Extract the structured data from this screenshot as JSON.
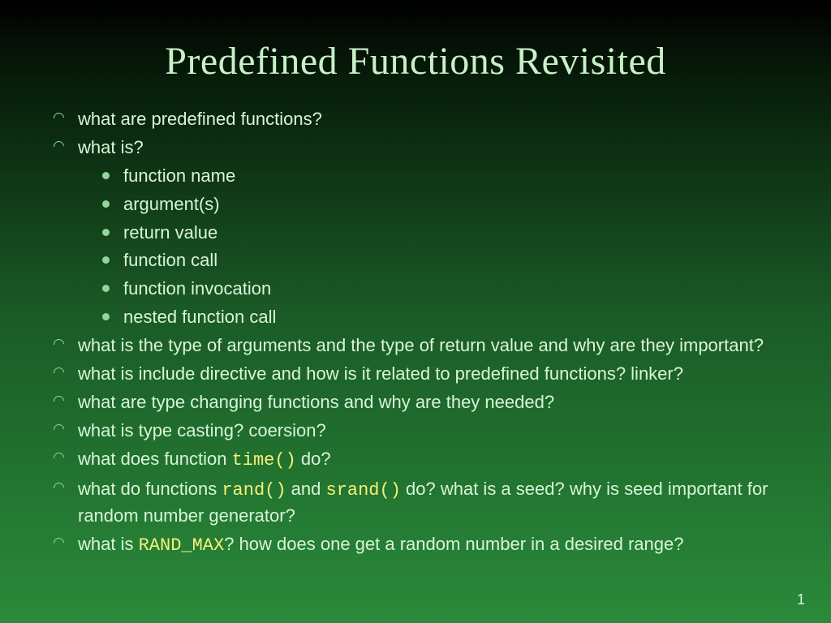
{
  "title": "Predefined Functions Revisited",
  "bullets": {
    "b1": "what are predefined functions?",
    "b2": "what is?",
    "b2_sub": {
      "s1": "function name",
      "s2": "argument(s)",
      "s3": "return value",
      "s4": "function call",
      "s5": "function invocation",
      "s6": "nested function call"
    },
    "b3": "what is the type of arguments and the type of return value and why are they important?",
    "b4": "what is include directive and how is it related to predefined functions? linker?",
    "b5": "what are type changing functions and why are they needed?",
    "b6": "what is type casting? coersion?",
    "b7_pre": "what does function ",
    "b7_code": "time()",
    "b7_post": " do?",
    "b8_pre": "what do functions ",
    "b8_code1": "rand()",
    "b8_mid": " and ",
    "b8_code2": "srand()",
    "b8_post": " do? what is a seed? why is seed important for random number generator?",
    "b9_pre": "what is ",
    "b9_code": "RAND_MAX",
    "b9_post": "? how does one get a random number in a desired range?"
  },
  "pagenum": "1"
}
